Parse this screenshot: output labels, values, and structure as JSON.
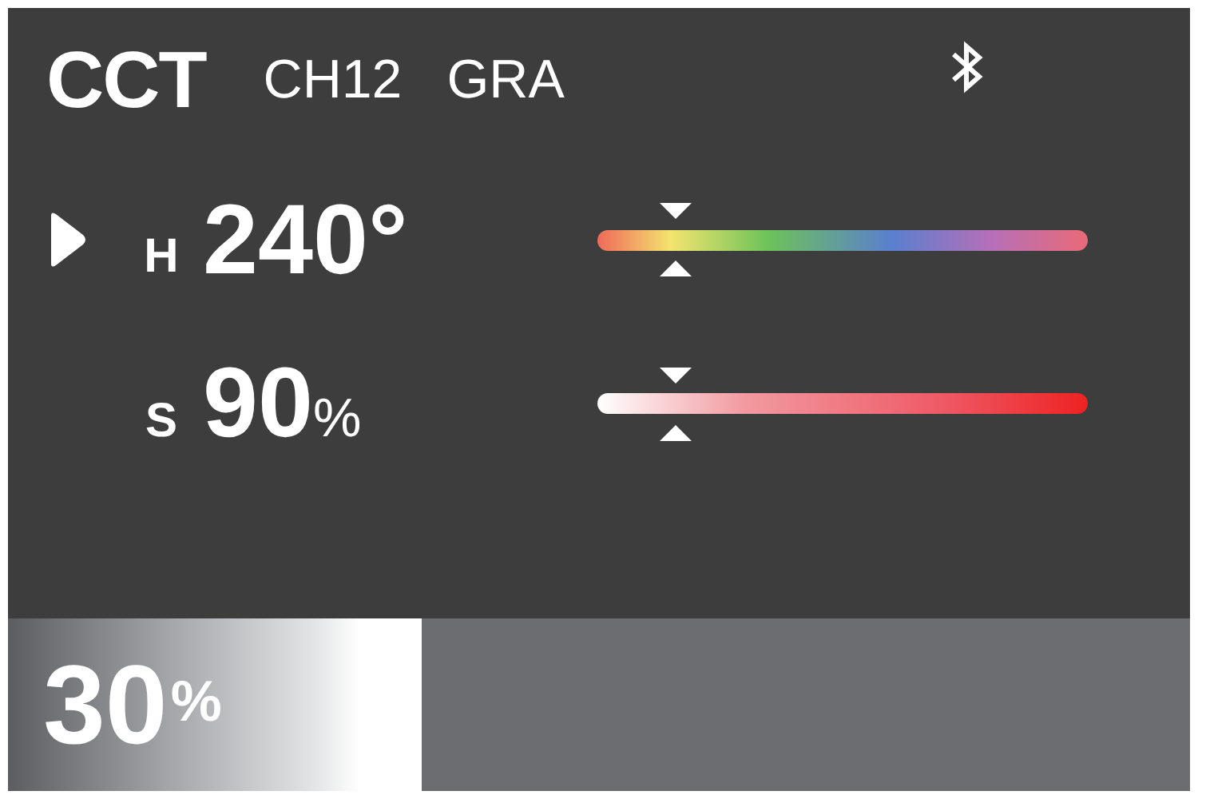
{
  "header": {
    "mode": "CCT",
    "channel": "CH12",
    "effect": "GRA"
  },
  "params": [
    {
      "kind": "hue",
      "label": "H",
      "value": "240°",
      "selected": true,
      "level": 0.16
    },
    {
      "kind": "saturation",
      "label": "S",
      "value": "90",
      "unit": "%",
      "selected": false,
      "level": 0.16
    }
  ],
  "brightness": {
    "value": "30",
    "unit": "%",
    "level": 0.35
  }
}
